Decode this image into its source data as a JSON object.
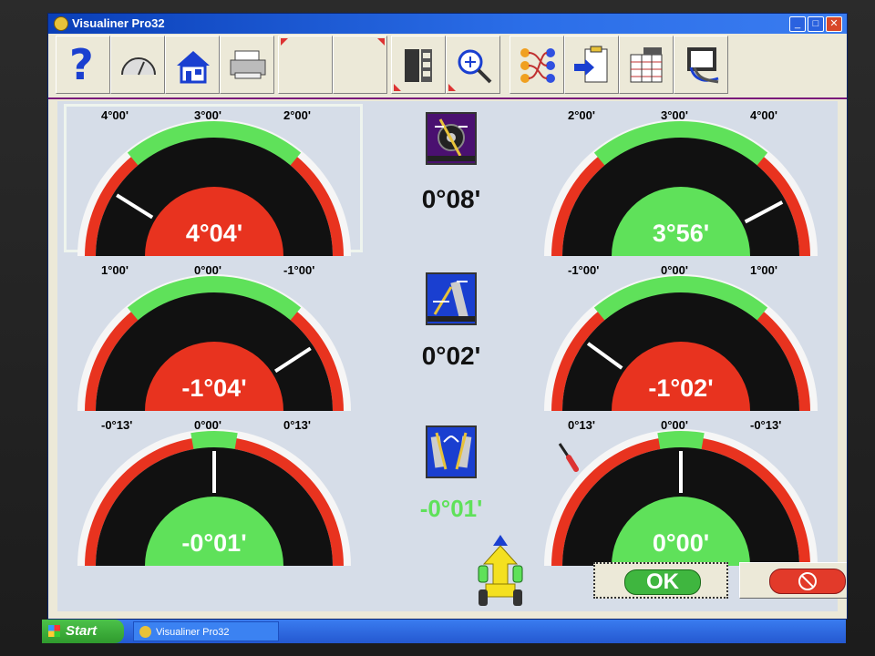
{
  "window": {
    "title": "Visualiner Pro32",
    "buttons": {
      "minimize": "_",
      "maximize": "□",
      "close": "✕"
    }
  },
  "toolbar": [
    {
      "name": "help-button",
      "icon": "question-icon",
      "label": "?"
    },
    {
      "name": "gauge-button",
      "icon": "speedometer-icon"
    },
    {
      "name": "home-button",
      "icon": "house-icon"
    },
    {
      "name": "print-button",
      "icon": "printer-icon"
    },
    {
      "name": "blank-button-1",
      "icon": ""
    },
    {
      "name": "blank-button-2",
      "icon": ""
    },
    {
      "name": "film-button",
      "icon": "film-icon"
    },
    {
      "name": "zoom-button",
      "icon": "magnifier-icon"
    },
    {
      "name": "network-button",
      "icon": "connections-icon"
    },
    {
      "name": "clipboard-button",
      "icon": "clipboard-arrow-icon"
    },
    {
      "name": "table-button",
      "icon": "spreadsheet-icon"
    },
    {
      "name": "diagnostics-button",
      "icon": "monitor-cable-icon"
    }
  ],
  "gauges": {
    "left_camber": {
      "ticks": [
        "4°00'",
        "3°00'",
        "2°00'"
      ],
      "value": "4°04'",
      "status": "red",
      "selected": true
    },
    "right_camber": {
      "ticks": [
        "2°00'",
        "3°00'",
        "4°00'"
      ],
      "value": "3°56'",
      "status": "green"
    },
    "left_caster": {
      "ticks": [
        "1°00'",
        "0°00'",
        "-1°00'"
      ],
      "value": "-1°04'",
      "status": "red"
    },
    "right_caster": {
      "ticks": [
        "-1°00'",
        "0°00'",
        "1°00'"
      ],
      "value": "-1°02'",
      "status": "red"
    },
    "left_toe": {
      "ticks": [
        "-0°13'",
        "0°00'",
        "0°13'"
      ],
      "value": "-0°01'",
      "status": "green"
    },
    "right_toe": {
      "ticks": [
        "0°13'",
        "0°00'",
        "-0°13'"
      ],
      "value": "0°00'",
      "status": "green"
    }
  },
  "center": {
    "cross_camber": {
      "icon": "wheel-camber-icon",
      "value": "0°08'"
    },
    "cross_caster": {
      "icon": "wheel-caster-icon",
      "value": "0°02'"
    },
    "total_toe": {
      "icon": "wheels-toe-icon",
      "value": "-0°01'"
    },
    "wrench_icon": "screwdriver-icon",
    "car_icon": "car-direction-icon"
  },
  "dialog": {
    "ok_label": "OK",
    "cancel_icon": "no-entry-icon"
  },
  "taskbar": {
    "start_label": "Start",
    "task_label": "Visualiner Pro32"
  },
  "colors": {
    "red": "#e8331f",
    "green": "#5fe15a",
    "frame": "#7a1a7a"
  }
}
